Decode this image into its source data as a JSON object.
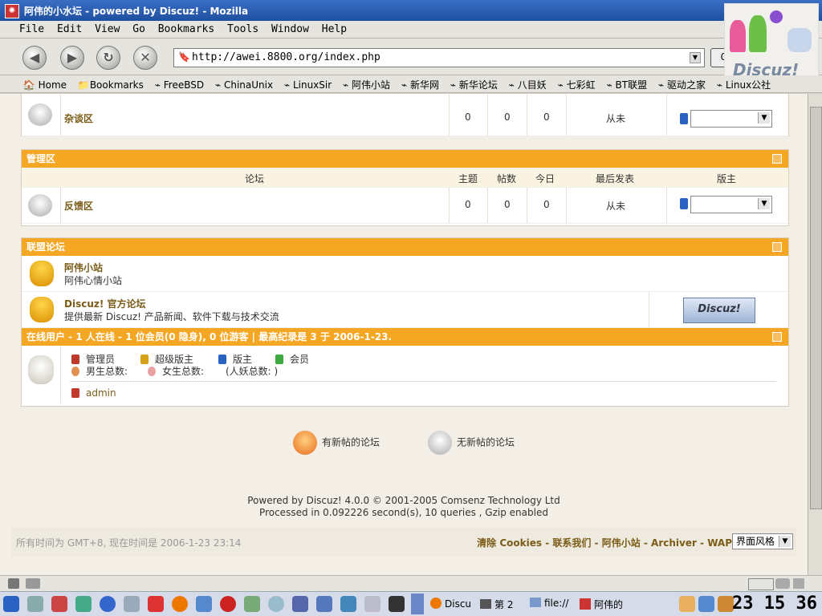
{
  "window": {
    "title": "阿伟的小水坛 - powered by Discuz! - Mozilla",
    "minimize": "▁",
    "maximize": "□",
    "close": "✕"
  },
  "menu": [
    "File",
    "Edit",
    "View",
    "Go",
    "Bookmarks",
    "Tools",
    "Window",
    "Help"
  ],
  "nav": {
    "back": "◀",
    "forward": "▶",
    "reload": "↻",
    "stop": "✕",
    "url": "http://awei.8800.org/index.php",
    "go_label": "Go",
    "logo_text": "Discuz!"
  },
  "bookmarks": [
    "Home",
    "Bookmarks",
    "FreeBSD",
    "ChinaUnix",
    "LinuxSir",
    "阿伟小站",
    "新华网",
    "新华论坛",
    "八目妖",
    "七彩虹",
    "BT联盟",
    "驱动之家",
    "Linux公社"
  ],
  "forum": {
    "top_row": {
      "name": "杂谈区",
      "topics": "0",
      "posts": "0",
      "today": "0",
      "last": "从未"
    },
    "admin_section": {
      "title": "管理区",
      "col_forum": "论坛",
      "col_topics": "主题",
      "col_posts": "帖数",
      "col_today": "今日",
      "col_last": "最后发表",
      "col_mod": "版主",
      "row": {
        "name": "反馈区",
        "topics": "0",
        "posts": "0",
        "today": "0",
        "last": "从未"
      }
    },
    "partners": {
      "title": "联盟论坛",
      "items": [
        {
          "name": "阿伟小站",
          "desc": "阿伟心情小站"
        },
        {
          "name": "Discuz! 官方论坛",
          "desc": "提供最新 Discuz! 产品新闻、软件下载与技术交流",
          "badge": "Discuz!"
        }
      ]
    },
    "online": {
      "title": "在线用户 - 1 人在线 - 1 位会员(0 隐身), 0 位游客 | 最高纪录是 3 于 2006-1-23.",
      "legend": [
        "管理员",
        "超级版主",
        "版主",
        "会员"
      ],
      "stats": [
        "男生总数:",
        "女生总数:",
        "(人妖总数: )"
      ],
      "user": "admin"
    }
  },
  "footer": {
    "new_label": "有新帖的论坛",
    "nonew_label": "无新帖的论坛",
    "powered": "Powered by Discuz! 4.0.0 © 2001-2005 Comsenz Technology Ltd",
    "processed": "Processed in 0.092226 second(s), 10 queries , Gzip enabled",
    "timezone": "所有时间为 GMT+8, 现在时间是 2006-1-23 23:14",
    "links": "清除 Cookies - 联系我们 - 阿伟小站 - Archiver - WAP",
    "style_select": "界面风格"
  },
  "taskbar": {
    "tasks": [
      "Discu",
      "第 2",
      "file://",
      "阿伟的"
    ],
    "clock": "23 15 36"
  },
  "colors": {
    "accent": "#f5a623",
    "link": "#7a5c17"
  }
}
